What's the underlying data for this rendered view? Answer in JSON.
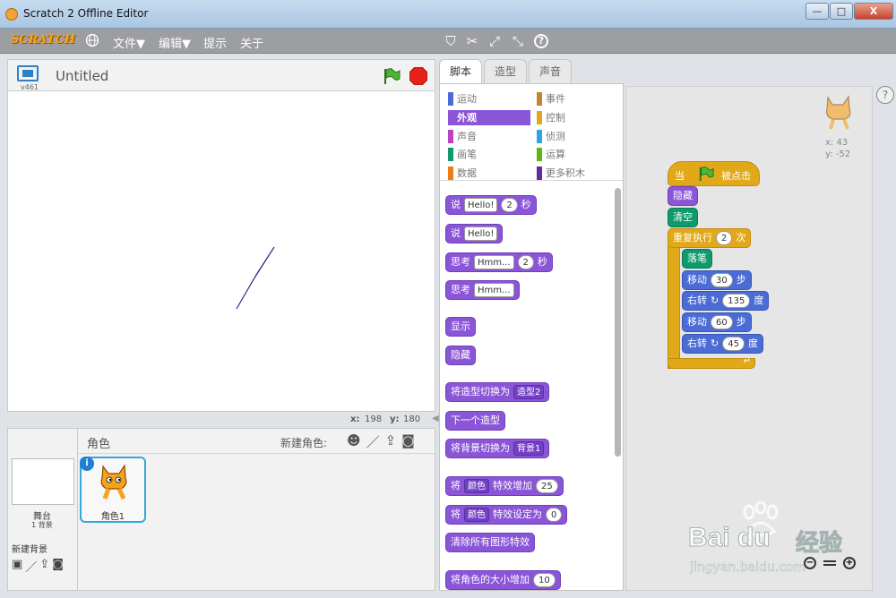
{
  "window": {
    "title": "Scratch 2 Offline Editor",
    "min_label": "—",
    "max_label": "□",
    "close_label": "X"
  },
  "menubar": {
    "logo": "SCRATCH",
    "items": [
      "文件▼",
      "编辑▼",
      "提示",
      "关于"
    ]
  },
  "stage": {
    "project_title": "Untitled",
    "version": "v461",
    "x_label": "x:",
    "x_value": "198",
    "y_label": "y:",
    "y_value": "180"
  },
  "sprites": {
    "header": "角色",
    "new_sprite_label": "新建角色:",
    "stage_label": "舞台",
    "stage_backdrops": "1 背景",
    "new_backdrop_label": "新建背景",
    "sprite_name": "角色1",
    "info_badge": "i"
  },
  "tabs": [
    "脚本",
    "造型",
    "声音"
  ],
  "categories": {
    "left": [
      {
        "label": "运动",
        "color": "#4a6cd4"
      },
      {
        "label": "外观",
        "color": "#8a55d7"
      },
      {
        "label": "声音",
        "color": "#bb42c3"
      },
      {
        "label": "画笔",
        "color": "#0e9a6c"
      },
      {
        "label": "数据",
        "color": "#ee7d16"
      }
    ],
    "right": [
      {
        "label": "事件",
        "color": "#c88330"
      },
      {
        "label": "控制",
        "color": "#e1a91a"
      },
      {
        "label": "侦测",
        "color": "#2ca5e2"
      },
      {
        "label": "运算",
        "color": "#5cb712"
      },
      {
        "label": "更多积木",
        "color": "#632d99"
      }
    ],
    "selected": 1
  },
  "palette_blocks": {
    "say_secs": {
      "say": "说",
      "msg": "Hello!",
      "secs": "2",
      "unit": "秒"
    },
    "say": {
      "say": "说",
      "msg": "Hello!"
    },
    "think_secs": {
      "think": "思考",
      "msg": "Hmm...",
      "secs": "2",
      "unit": "秒"
    },
    "think": {
      "think": "思考",
      "msg": "Hmm..."
    },
    "show": "显示",
    "hide": "隐藏",
    "switch_costume": {
      "label": "将造型切换为",
      "value": "造型2"
    },
    "next_costume": "下一个造型",
    "switch_backdrop": {
      "label": "将背景切换为",
      "value": "背景1"
    },
    "change_effect": {
      "pre": "将",
      "effect": "颜色",
      "mid": "特效增加",
      "value": "25"
    },
    "set_effect": {
      "pre": "将",
      "effect": "颜色",
      "mid": "特效设定为",
      "value": "0"
    },
    "clear_effects": "清除所有图形特效",
    "change_size": {
      "label": "将角色的大小增加",
      "value": "10"
    }
  },
  "script": {
    "hat_when": "当",
    "hat_clicked": "被点击",
    "hide": "隐藏",
    "clear": "清空",
    "repeat": {
      "label": "重复执行",
      "count": "2",
      "unit": "次"
    },
    "pen_down": "落笔",
    "move1": {
      "label": "移动",
      "value": "30",
      "unit": "步"
    },
    "turn1": {
      "label": "右转",
      "value": "135",
      "unit": "度"
    },
    "move2": {
      "label": "移动",
      "value": "60",
      "unit": "步"
    },
    "turn2": {
      "label": "右转",
      "value": "45",
      "unit": "度"
    }
  },
  "sprite_info": {
    "x_label": "x:",
    "x_value": "43",
    "y_label": "y:",
    "y_value": "-52"
  },
  "watermark": {
    "brand": "Bai du",
    "brand_cn": "经验",
    "url": "jingyan.baidu.com"
  },
  "colors": {
    "motion": "#4a6cd4",
    "looks": "#8a55d7",
    "pen": "#0e9a6c",
    "control": "#e1a91a",
    "events": "#c88330"
  }
}
